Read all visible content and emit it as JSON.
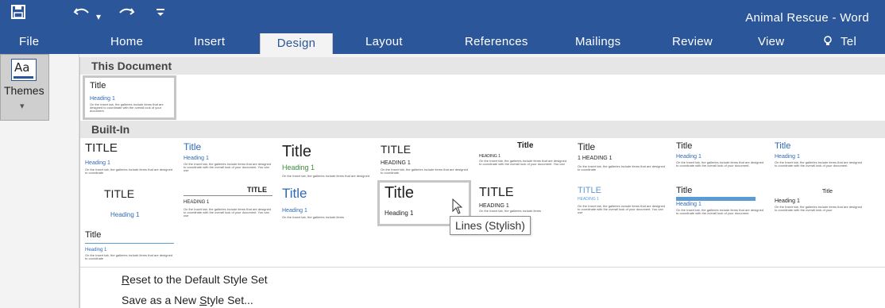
{
  "window": {
    "title": "Animal Rescue - Word"
  },
  "qat": {
    "save_icon": "save-icon",
    "undo_icon": "undo-icon",
    "redo_icon": "redo-icon",
    "customize_icon": "customize-qat-icon"
  },
  "tabs": [
    {
      "label": "File"
    },
    {
      "label": "Home"
    },
    {
      "label": "Insert"
    },
    {
      "label": "Design",
      "active": true
    },
    {
      "label": "Layout"
    },
    {
      "label": "References"
    },
    {
      "label": "Mailings"
    },
    {
      "label": "Review"
    },
    {
      "label": "View"
    },
    {
      "label": "Tel"
    }
  ],
  "themes": {
    "label": "Themes",
    "icon_text": "Aa"
  },
  "gallery": {
    "this_document_header": "This Document",
    "builtin_header": "Built-In",
    "this_document_item": {
      "title": "Title",
      "heading": "Heading 1",
      "body": "On the Insert tab, the galleries include items that are designed to coordinate with the overall look of your document."
    },
    "styles": [
      {
        "title": "TITLE",
        "heading": "Heading 1",
        "body": "On the Insert tab, the galleries include items that are designed to coordinate"
      },
      {
        "title": "Title",
        "heading": "Heading 1",
        "body": "On the Insert tab, the galleries include items that are designed to coordinate with the overall look of your document. You can use"
      },
      {
        "title": "Title",
        "heading": "Heading 1",
        "body": "On the Insert tab, the galleries include items that are designed"
      },
      {
        "title": "TITLE",
        "heading": "HEADING 1",
        "body": "On the Insert tab, the galleries include items that are designed to coordinate"
      },
      {
        "title": "Title",
        "heading": "HEADING 1",
        "body": "On the Insert tab, the galleries include items that are designed to coordinate with the overall look of your document. You can"
      },
      {
        "title": "Title",
        "heading": "1 HEADING 1",
        "body": "On the Insert tab, the galleries include items that are designed to coordinate"
      },
      {
        "title": "Title",
        "heading": "Heading 1",
        "body": "On the Insert tab, the galleries include items that are designed to coordinate with the overall look of your document."
      },
      {
        "title": "Title",
        "heading": "Heading 1",
        "body": "On the Insert tab, the galleries include items that are designed to coordinate with the overall look of your document."
      },
      {
        "title": "TITLE",
        "heading": "Heading 1",
        "body": ""
      },
      {
        "title": "TITLE",
        "heading": "HEADING 1",
        "body": "On the Insert tab, the galleries include items that are designed to coordinate with the overall look of your document. You can use"
      },
      {
        "title": "Title",
        "heading": "Heading 1",
        "body": "On the Insert tab, the galleries include items"
      },
      {
        "title": "Title",
        "heading": "Heading 1",
        "body": ""
      },
      {
        "title": "TITLE",
        "heading": "HEADING 1",
        "body": "On the Insert tab, the galleries include items"
      },
      {
        "title": "TITLE",
        "heading": "HEADING 1",
        "body": "On the Insert tab, the galleries include items that are designed to coordinate with the overall look of your document. You can use"
      },
      {
        "title": "Title",
        "heading": "Heading 1",
        "body": "On the Insert tab, the galleries include items that are designed to coordinate with the overall look of your document."
      },
      {
        "title": "Title",
        "heading": "Heading 1",
        "body": "On the Insert tab, the galleries include items that are designed to coordinate with the overall look of your"
      },
      {
        "title": "Title",
        "heading": "Heading 1",
        "body": "On the Insert tab, the galleries include items that are designed to coordinate"
      }
    ],
    "tooltip": "Lines (Stylish)"
  },
  "menu": {
    "reset_pre": "",
    "reset_underline": "R",
    "reset_post": "eset to the Default Style Set",
    "save_pre": "Save as a New ",
    "save_underline": "S",
    "save_post": "tyle Set..."
  },
  "colors": {
    "ribbon_blue": "#2b579a",
    "heading_blue": "#2e6ab5",
    "accent_blue": "#5b9bd5"
  }
}
